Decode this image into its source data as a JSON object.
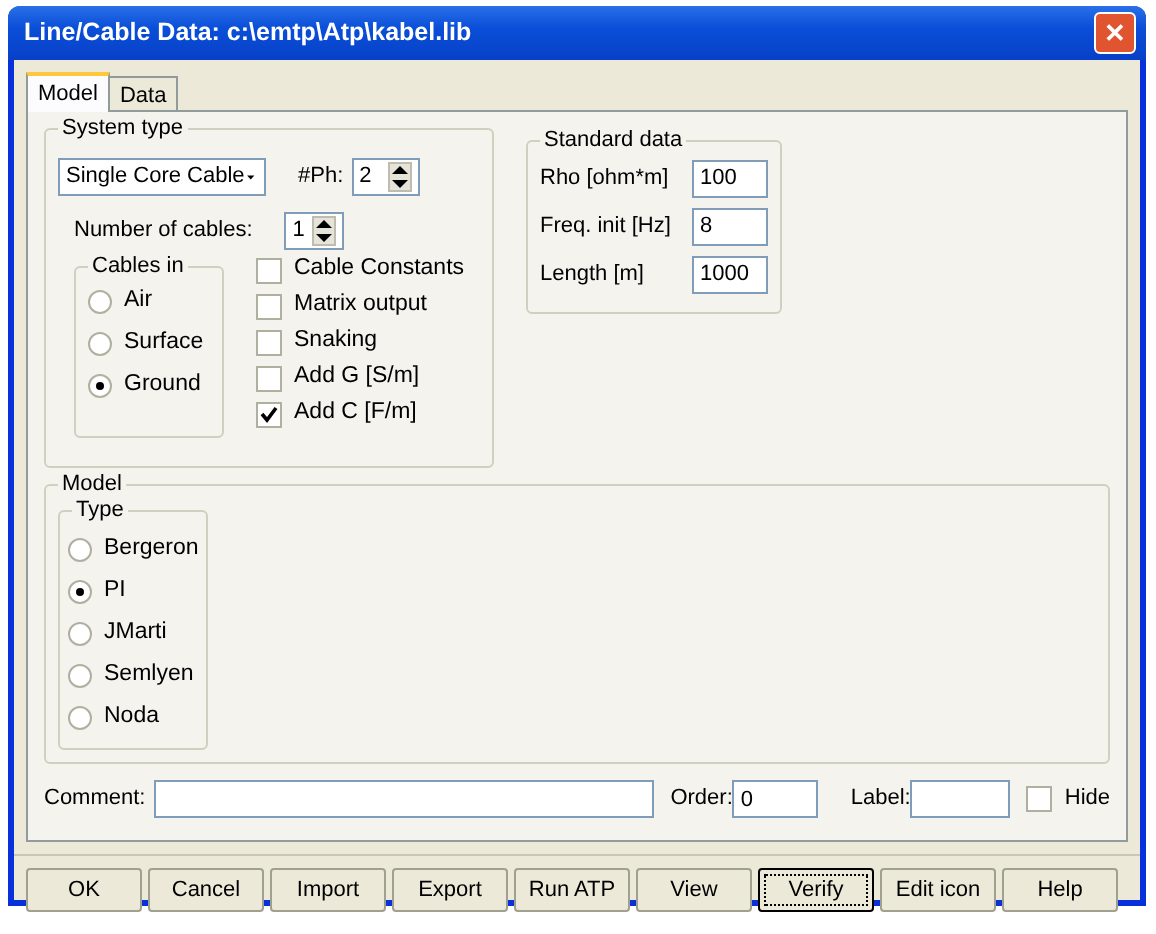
{
  "window": {
    "title": "Line/Cable Data: c:\\emtp\\Atp\\kabel.lib",
    "close": "✕"
  },
  "tabs": [
    {
      "label": "Model",
      "selected": true
    },
    {
      "label": "Data",
      "selected": false
    }
  ],
  "system_type": {
    "title": "System type",
    "cable_type": "Single Core Cable",
    "phases_label": "#Ph:",
    "phases": "2",
    "cables_label": "Number of cables:",
    "cables": "1",
    "cables_in": {
      "title": "Cables in",
      "options": [
        {
          "label": "Air",
          "selected": false
        },
        {
          "label": "Surface",
          "selected": false
        },
        {
          "label": "Ground",
          "selected": true
        }
      ]
    },
    "checkboxes": [
      {
        "label": "Cable Constants",
        "checked": false
      },
      {
        "label": "Matrix output",
        "checked": false
      },
      {
        "label": "Snaking",
        "checked": false
      },
      {
        "label": "Add G [S/m]",
        "checked": false
      },
      {
        "label": "Add C [F/m]",
        "checked": true
      }
    ]
  },
  "standard_data": {
    "title": "Standard data",
    "fields": [
      {
        "label": "Rho [ohm*m]",
        "value": "100"
      },
      {
        "label": "Freq. init [Hz]",
        "value": "8"
      },
      {
        "label": "Length [m]",
        "value": "1000"
      }
    ]
  },
  "model": {
    "title": "Model",
    "type_title": "Type",
    "types": [
      {
        "label": "Bergeron",
        "selected": false
      },
      {
        "label": "PI",
        "selected": true
      },
      {
        "label": "JMarti",
        "selected": false
      },
      {
        "label": "Semlyen",
        "selected": false
      },
      {
        "label": "Noda",
        "selected": false
      }
    ]
  },
  "footer": {
    "comment_label": "Comment:",
    "order_label": "Order:",
    "order": "0",
    "label_label": "Label:",
    "hide_label": "Hide",
    "hide": false
  },
  "buttons": [
    {
      "label": "OK",
      "focused": false
    },
    {
      "label": "Cancel",
      "focused": false
    },
    {
      "label": "Import",
      "focused": false
    },
    {
      "label": "Export",
      "focused": false
    },
    {
      "label": "Run ATP",
      "focused": false
    },
    {
      "label": "View",
      "focused": false
    },
    {
      "label": "Verify",
      "focused": true
    },
    {
      "label": "Edit icon",
      "focused": false
    },
    {
      "label": "Help",
      "focused": false
    }
  ]
}
